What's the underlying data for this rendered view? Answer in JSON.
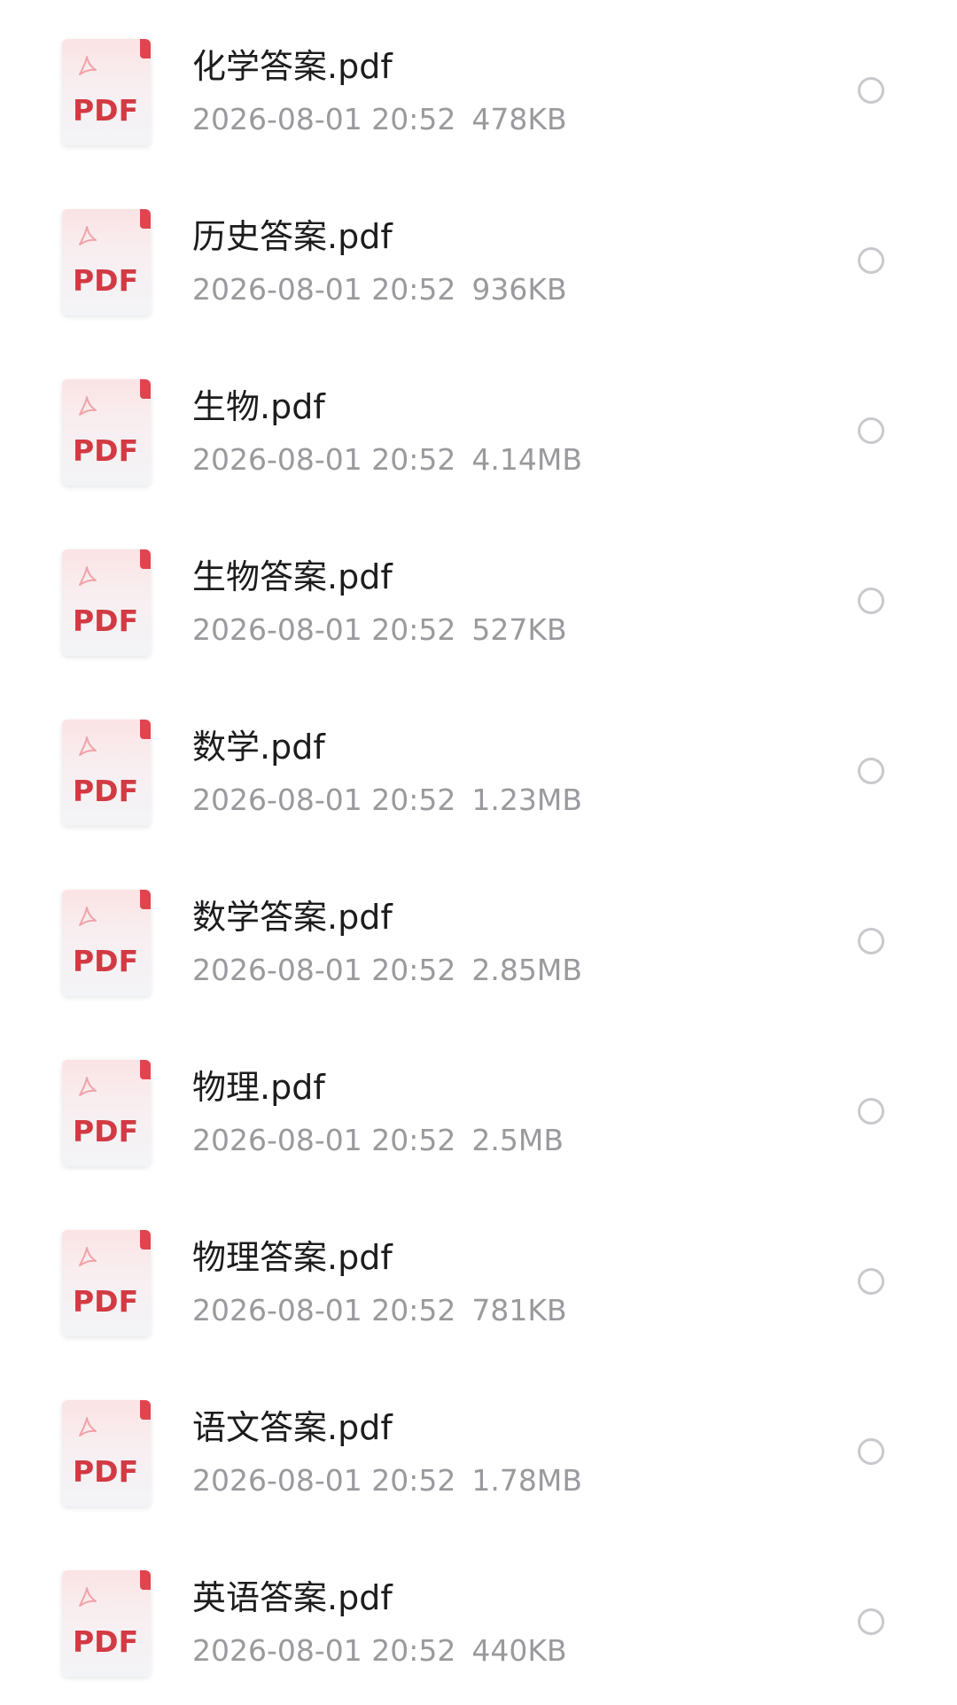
{
  "files": [
    {
      "name": "化学答案.pdf",
      "date": "2026-08-01 20:52",
      "size": "478KB",
      "thumb_label": "PDF",
      "icon": "pdf-file-icon"
    },
    {
      "name": "历史答案.pdf",
      "date": "2026-08-01 20:52",
      "size": "936KB",
      "thumb_label": "PDF",
      "icon": "pdf-file-icon"
    },
    {
      "name": "生物.pdf",
      "date": "2026-08-01 20:52",
      "size": "4.14MB",
      "thumb_label": "PDF",
      "icon": "pdf-file-icon"
    },
    {
      "name": "生物答案.pdf",
      "date": "2026-08-01 20:52",
      "size": "527KB",
      "thumb_label": "PDF",
      "icon": "pdf-file-icon"
    },
    {
      "name": "数学.pdf",
      "date": "2026-08-01 20:52",
      "size": "1.23MB",
      "thumb_label": "PDF",
      "icon": "pdf-file-icon"
    },
    {
      "name": "数学答案.pdf",
      "date": "2026-08-01 20:52",
      "size": "2.85MB",
      "thumb_label": "PDF",
      "icon": "pdf-file-icon"
    },
    {
      "name": "物理.pdf",
      "date": "2026-08-01 20:52",
      "size": "2.5MB",
      "thumb_label": "PDF",
      "icon": "pdf-file-icon"
    },
    {
      "name": "物理答案.pdf",
      "date": "2026-08-01 20:52",
      "size": "781KB",
      "thumb_label": "PDF",
      "icon": "pdf-file-icon"
    },
    {
      "name": "语文答案.pdf",
      "date": "2026-08-01 20:52",
      "size": "1.78MB",
      "thumb_label": "PDF",
      "icon": "pdf-file-icon"
    },
    {
      "name": "英语答案.pdf",
      "date": "2026-08-01 20:52",
      "size": "440KB",
      "thumb_label": "PDF",
      "icon": "pdf-file-icon"
    }
  ],
  "colors": {
    "pdf_red": "#d23a44",
    "name_text": "#1c1c1e",
    "meta_text": "#9a9a9e",
    "radio_border": "#c9c9cd"
  }
}
